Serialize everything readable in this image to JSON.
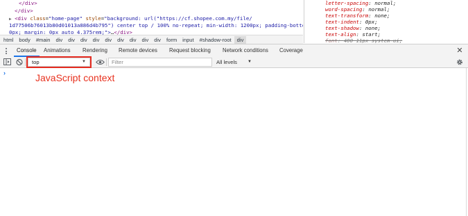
{
  "elements": {
    "line1": "</div>",
    "line2": "</div>",
    "line3_tag_open": "<div",
    "line3_class_name": "class",
    "line3_class_val": "\"home-page\"",
    "line3_style_name": "style",
    "line3_style_val_part1": "\"background: url(\"https://cf.shopee.com.my/file/",
    "line4": "1d77506b76013b80d01013a886d4b795\") center top / 100% no-repeat; min-width: 1200px; padding-bottom:",
    "line5_text": "0px; margin: 0px auto 4.375rem;\">",
    "line5_ellipsis": "…",
    "line5_close": "</div>"
  },
  "styles": [
    {
      "prop": "letter-spacing",
      "val": "normal;",
      "struck": false
    },
    {
      "prop": "word-spacing",
      "val": "normal;",
      "struck": false
    },
    {
      "prop": "text-transform",
      "val": "none;",
      "struck": false
    },
    {
      "prop": "text-indent",
      "val": "0px;",
      "struck": false
    },
    {
      "prop": "text-shadow",
      "val": "none;",
      "struck": false
    },
    {
      "prop": "text-align",
      "val": "start;",
      "struck": false
    },
    {
      "prop": "font",
      "val": "400 11px system-ui;",
      "struck": true
    }
  ],
  "breadcrumbs": [
    "html",
    "body",
    "#main",
    "div",
    "div",
    "div",
    "div",
    "div",
    "div",
    "div",
    "div",
    "div",
    "form",
    "input",
    "#shadow-root",
    "div"
  ],
  "tabs": [
    "Console",
    "Animations",
    "Rendering",
    "Remote devices",
    "Request blocking",
    "Network conditions",
    "Coverage"
  ],
  "active_tab": "Console",
  "toolbar": {
    "context_value": "top",
    "filter_placeholder": "Filter",
    "levels_label": "All levels"
  },
  "console": {
    "prompt_symbol": "›"
  },
  "annotation": {
    "text": "JavaScript context",
    "color": "#e8321f"
  },
  "colors": {
    "accent": "#1a73e8",
    "highlight": "#e52b20"
  }
}
